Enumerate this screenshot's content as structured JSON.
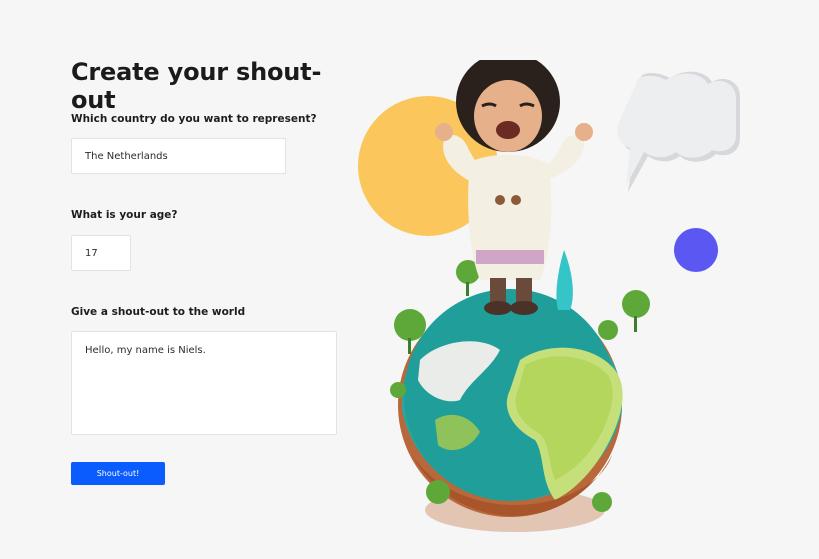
{
  "form": {
    "title": "Create your shout-out",
    "country": {
      "label": "Which country do you want to represent?",
      "value": "The Netherlands"
    },
    "age": {
      "label": "What is your age?",
      "value": "17"
    },
    "shoutout": {
      "label": "Give a shout-out to the world",
      "value": "Hello, my name is Niels."
    },
    "submit_label": "Shout-out!"
  },
  "colors": {
    "background": "#f6f6f6",
    "accent": "#0b5cff",
    "yellow_circle": "#fbc65c",
    "purple_dot": "#5b57f2"
  },
  "illustration": {
    "icons": [
      "speech-bubble-icon",
      "globe-illustration",
      "child-figure"
    ]
  }
}
